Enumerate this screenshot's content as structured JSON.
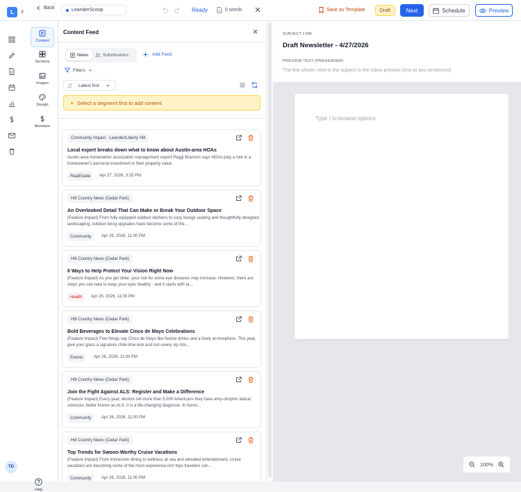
{
  "topbar": {
    "app_badge": "L",
    "back_label": "Back",
    "publication": "LeanderScoop",
    "status": "Ready",
    "word_count": "0 words",
    "save_template": "Save as Template",
    "draft_badge": "Draft",
    "next": "Next",
    "schedule": "Schedule",
    "preview": "Preview"
  },
  "rail": {
    "items": [
      {
        "label": "Content",
        "icon": "grid-icon",
        "active": true
      },
      {
        "label": "Sections",
        "icon": "sections-icon"
      },
      {
        "label": "Images",
        "icon": "image-icon"
      },
      {
        "label": "Design",
        "icon": "palette-icon"
      },
      {
        "label": "Monetize",
        "icon": "dollar-icon"
      }
    ],
    "user_initials": "TD",
    "help_label": "Help"
  },
  "feed": {
    "title": "Content Feed",
    "tabs": [
      "News",
      "Submissions"
    ],
    "add_feed": "Add Feed",
    "filters": "Filters",
    "sort": "Latest first",
    "segment_notice": "Select a segment first to add content",
    "cards": [
      {
        "source": "Community Impact - Leander/Liberty Hill",
        "headline": "Local expert breaks down what to know about Austin-area HOAs",
        "summary": "Austin-area homeowner association management expert Peggi Brannon says HOAs play a role in a homeowner's personal investment in their property value.",
        "tag": "RealEstate",
        "time": "Apr 27, 2026, 3:25 PM"
      },
      {
        "source": "Hill Country News (Cedar Park)",
        "headline": "An Overlooked Detail That Can Make or Break Your Outdoor Space",
        "summary": "(Feature Impact) From fully equipped outdoor kitchens to cozy lounge seating and thoughtfully designed landscaping, outdoor living upgrades have become some of the...",
        "tag": "Community",
        "time": "Apr 26, 2026, 11:00 PM"
      },
      {
        "source": "Hill Country News (Cedar Park)",
        "headline": "8 Ways to Help Protect Your Vision Right Now",
        "summary": "(Feature Impact) As you get older, your risk for some eye diseases may increase. However, there are steps you can take to keep your eyes healthy - and it starts with ta...",
        "tag": "Health",
        "time": "Apr 26, 2026, 11:00 PM"
      },
      {
        "source": "Hill Country News (Cedar Park)",
        "headline": "Bold Beverages to Elevate Cinco de Mayo Celebrations",
        "summary": "(Feature Impact) Few things say Cinco de Mayo like festive drinks and a lively at-mosphere. This year, give your glass a signature chile-lime kick and turn every sip into...",
        "tag": "Events",
        "time": "Apr 26, 2026, 11:00 PM"
      },
      {
        "source": "Hill Country News (Cedar Park)",
        "headline": "Join the Fight Against ALS: Register and Make a Difference",
        "summary": "(Feature Impact) Every year, doctors tell more than 5,000 Americans they have amy-otrophic lateral sclerosis, better known as ALS. It is a life-changing diagnosis. In honor...",
        "tag": "Community",
        "time": "Apr 26, 2026, 11:00 PM"
      },
      {
        "source": "Hill Country News (Cedar Park)",
        "headline": "Top Trends for Swoon-Worthy Cruise Vacations",
        "summary": "(Feature Impact) From immersive dining to wellness at sea and elevated entertainment, cruise vacations are becoming some of the most experience-rich trips travelers can...",
        "tag": "Community",
        "time": "Apr 26, 2026, 11:00 PM"
      }
    ]
  },
  "editor": {
    "subject_label": "SUBJECT LINE",
    "subject_value": "Draft Newsletter - 4/27/2026",
    "preheader_label": "PREVIEW TEXT (PREHEADER)",
    "preheader_placeholder": "The line shown next to the subject in the inbox preview (one to two sentences)",
    "canvas_placeholder": "Type / to browse options",
    "zoom": "100%"
  },
  "colors": {
    "accent": "#2563eb",
    "warning_bg": "#fef3c7",
    "warning_text": "#b45309",
    "trash": "#ea580c"
  }
}
